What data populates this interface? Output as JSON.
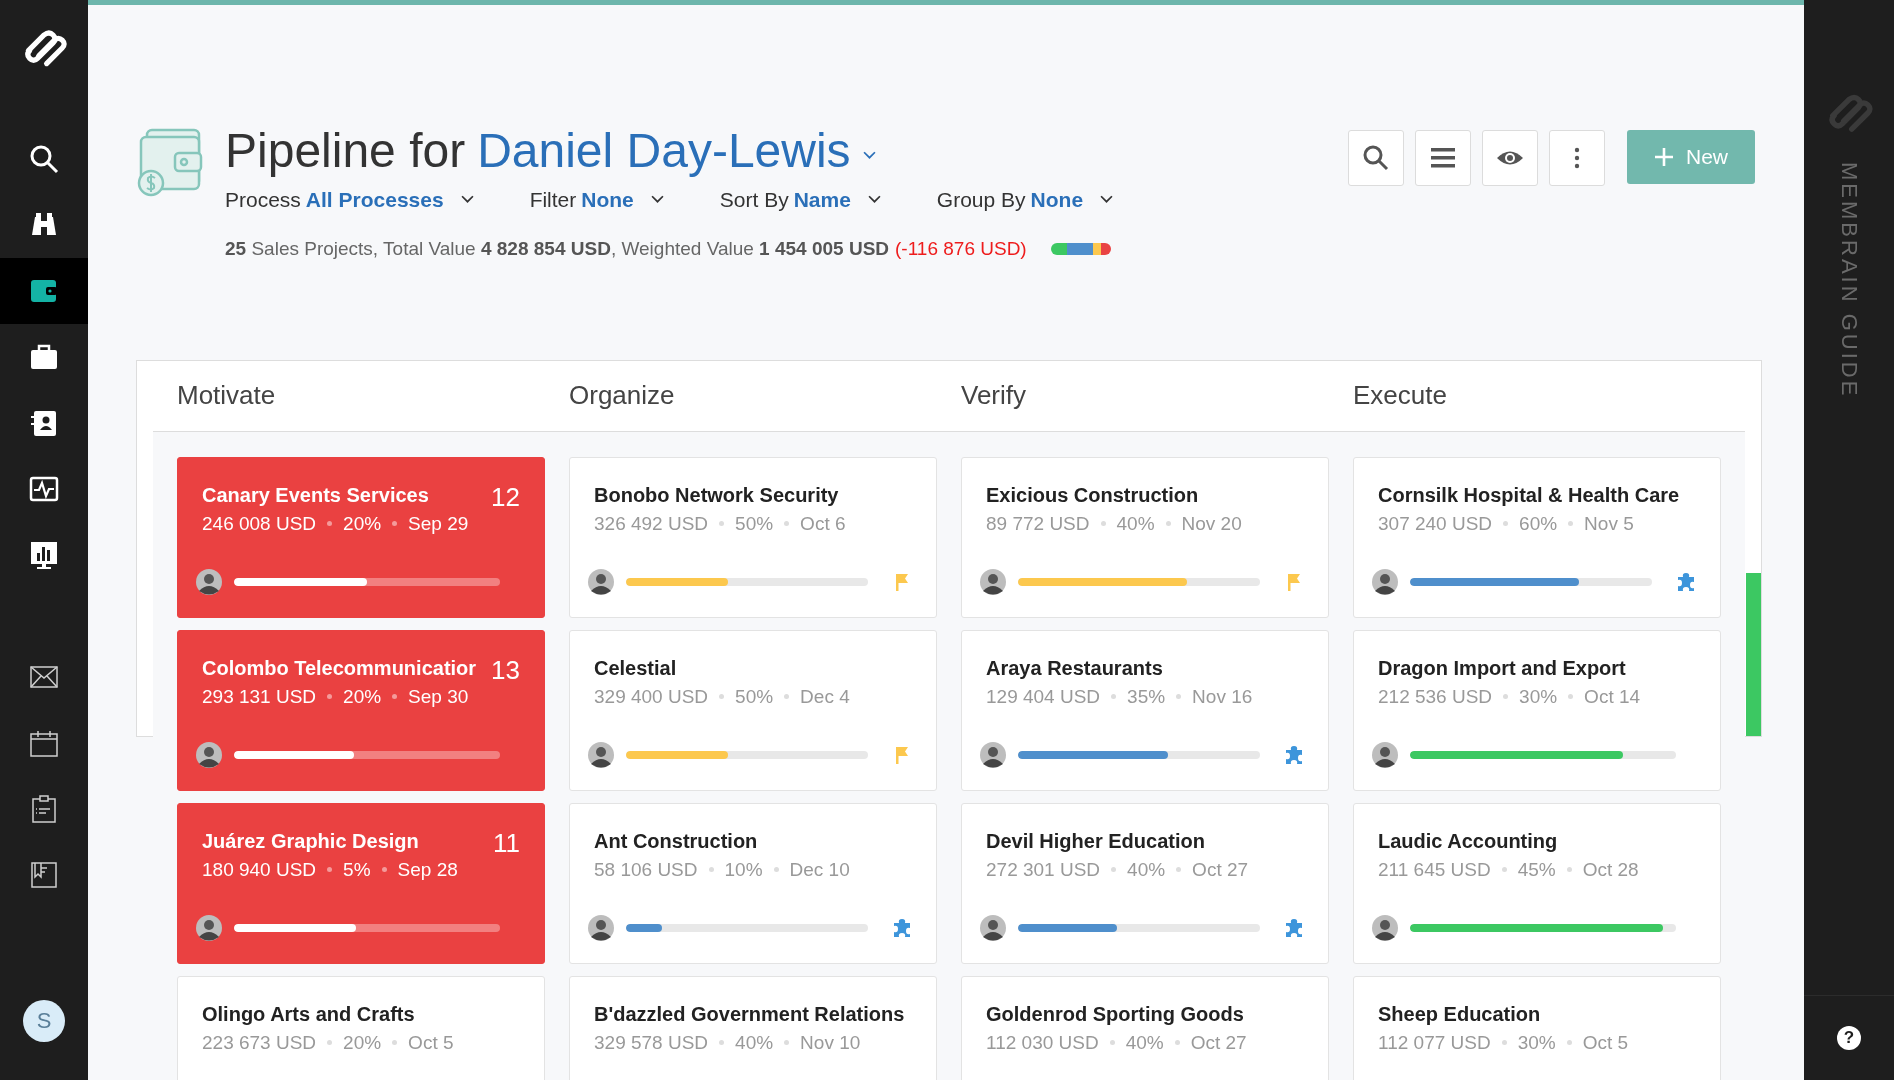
{
  "sidebar": {
    "items": [
      {
        "selected": false
      },
      {
        "selected": false
      },
      {
        "selected": true
      },
      {
        "selected": false
      },
      {
        "selected": false
      },
      {
        "selected": false
      },
      {
        "selected": false
      }
    ],
    "lower_items": [
      {
        "selected": false
      },
      {
        "selected": false
      },
      {
        "selected": false
      },
      {
        "selected": false
      }
    ],
    "user_initial": "S"
  },
  "header": {
    "title": "Pipeline for",
    "person": "Daniel Day-Lewis",
    "filters": [
      {
        "label": "Process",
        "value": "All Processes"
      },
      {
        "label": "Filter",
        "value": "None"
      },
      {
        "label": "Sort By",
        "value": "Name"
      },
      {
        "label": "Group By",
        "value": "None"
      }
    ],
    "summary": "**25** Sales Projects, Total Value **4 828 854 USD**, Weighted Value **1 454 005 USD**",
    "difference": "(-116 876 USD)",
    "new_button": "New"
  },
  "board": {
    "columns": [
      {
        "title": "Motivate",
        "cards": [
          {
            "kind": "overdue",
            "name": "Canary Events Services",
            "value": "246 008 USD",
            "percent": "20%",
            "date": "Sep 29",
            "count": "12",
            "level": 0.5
          },
          {
            "kind": "overdue",
            "name": "Colombo Telecommunicatior",
            "value": "293 131 USD",
            "percent": "20%",
            "date": "Sep 30",
            "count": "13",
            "level": 0.45
          },
          {
            "kind": "overdue",
            "name": "Juárez Graphic Design",
            "value": "180 940 USD",
            "percent": "5%",
            "date": "Sep 28",
            "count": "11",
            "level": 0.46
          },
          {
            "name": "Olingo Arts and Crafts",
            "value": "223 673 USD",
            "percent": "20%",
            "date": "Oct 5"
          }
        ]
      },
      {
        "title": "Organize",
        "cards": [
          {
            "kind": "flag",
            "name": "Bonobo Network Security",
            "value": "326 492 USD",
            "percent": "50%",
            "date": "Oct 6",
            "level": 0.42
          },
          {
            "kind": "flag",
            "name": "Celestial",
            "value": "329 400 USD",
            "percent": "50%",
            "date": "Dec 4",
            "level": 0.42
          },
          {
            "kind": "puzzle",
            "name": "Ant Construction",
            "value": "58 106 USD",
            "percent": "10%",
            "date": "Dec 10",
            "level": 0.15
          },
          {
            "name": "B'dazzled Government Relations",
            "value": "329 578 USD",
            "percent": "40%",
            "date": "Nov 10"
          }
        ]
      },
      {
        "title": "Verify",
        "cards": [
          {
            "kind": "flag",
            "name": "Exicious Construction",
            "value": "89 772 USD",
            "percent": "40%",
            "date": "Nov 20",
            "level": 0.7
          },
          {
            "kind": "puzzle",
            "name": "Araya Restaurants",
            "value": "129 404 USD",
            "percent": "35%",
            "date": "Nov 16",
            "level": 0.62
          },
          {
            "kind": "puzzle",
            "name": "Devil Higher Education",
            "value": "272 301 USD",
            "percent": "40%",
            "date": "Oct 27",
            "level": 0.41
          },
          {
            "name": "Goldenrod Sporting Goods",
            "value": "112 030 USD",
            "percent": "40%",
            "date": "Oct 27"
          }
        ]
      },
      {
        "title": "Execute",
        "cards": [
          {
            "kind": "puzzle",
            "name": "Cornsilk Hospital & Health Care",
            "value": "307 240 USD",
            "percent": "60%",
            "date": "Nov 5",
            "level": 0.7
          },
          {
            "kind": "plain",
            "name": "Dragon Import and Export",
            "value": "212 536 USD",
            "percent": "30%",
            "date": "Oct 14",
            "level": 0.8
          },
          {
            "kind": "plain",
            "name": "Laudic Accounting",
            "value": "211 645 USD",
            "percent": "45%",
            "date": "Oct 28",
            "level": 0.95
          },
          {
            "name": "Sheep Education",
            "value": "112 077 USD",
            "percent": "30%",
            "date": "Oct 5"
          }
        ]
      }
    ]
  },
  "guide": {
    "label": "MEMBRAIN GUIDE",
    "help": "?"
  }
}
